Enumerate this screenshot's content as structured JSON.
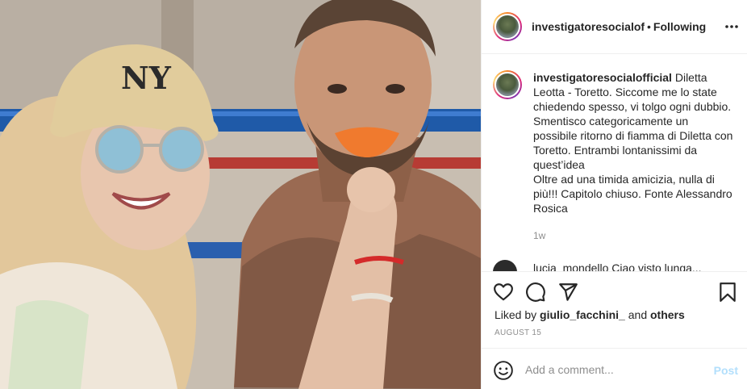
{
  "post": {
    "image_alt": "Photo of two people smiling in a boxing gym",
    "author": "investigatoresocialofficial",
    "author_truncated": "investigatoresocialoffic",
    "separator": "•",
    "follow_status": "Following",
    "more_icon": "more-horizontal-icon"
  },
  "caption": {
    "author": "investigatoresocialofficial",
    "body": " Diletta Leotta - Toretto. Siccome me lo state chiedendo spesso, vi tolgo ogni dubbio. Smentisco categoricamente un possibile ritorno di fiamma di Diletta con Toretto. Entrambi lontanissimi da quest’idea\nOltre ad una timida amicizia, nulla di più!!! Capitolo chiuso. Fonte Alessandro Rosica",
    "time_ago": "1w"
  },
  "comment_peek": {
    "text": "lucia_mondello Ciao visto lunga..."
  },
  "actions": {
    "like_icon": "heart-icon",
    "comment_icon": "comment-icon",
    "share_icon": "share-icon",
    "save_icon": "bookmark-icon"
  },
  "likes": {
    "prefix": "Liked by ",
    "user": "giulio_facchini_",
    "joiner": " and ",
    "others": "others"
  },
  "date": "AUGUST 15",
  "comment_box": {
    "placeholder": "Add a comment...",
    "post_label": "Post",
    "emoji_icon": "smiley-icon"
  },
  "colors": {
    "text": "#262626",
    "muted": "#8e8e8e",
    "post_disabled": "#b2dffc",
    "border": "#efefef"
  }
}
